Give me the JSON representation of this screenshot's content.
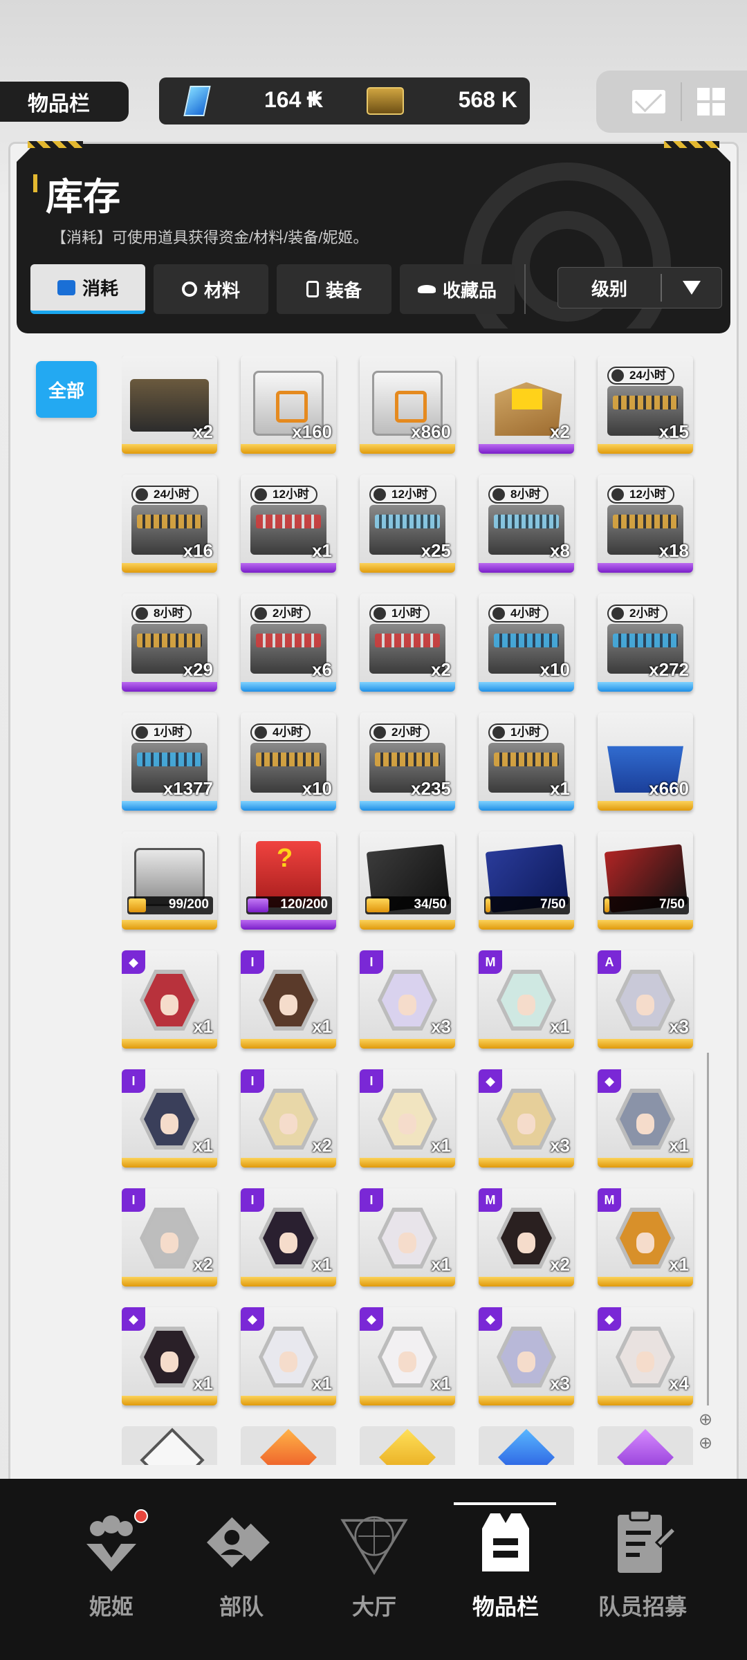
{
  "top_bar": {
    "label": "物品栏",
    "gems": "164 K",
    "plus": "+",
    "credits": "568 K",
    "icons": [
      "gem-icon",
      "ticket-icon",
      "mail-icon",
      "grid-menu-icon"
    ]
  },
  "header": {
    "title": "库存",
    "subtitle": "【消耗】可使用道具获得资金/材料/装备/妮姬。",
    "tabs": [
      {
        "label": "消耗",
        "icon": "consumable-icon"
      },
      {
        "label": "材料",
        "icon": "material-icon"
      },
      {
        "label": "装备",
        "icon": "equipment-icon"
      },
      {
        "label": "收藏品",
        "icon": "collectible-icon"
      }
    ],
    "sort_label": "级别"
  },
  "filter": {
    "all_label": "全部"
  },
  "colors": {
    "accent": "#23a9f2",
    "rarity_orange": "#e09a0c",
    "rarity_purple": "#7a1fc9",
    "rarity_blue": "#1f8fe6",
    "badge_purple": "#7a28d6",
    "notification": "#e8463d"
  },
  "items": [
    {
      "kind": "dark",
      "qty": "x2",
      "rarity": "orange"
    },
    {
      "kind": "crate",
      "qty": "x160",
      "rarity": "orange"
    },
    {
      "kind": "crate",
      "qty": "x860",
      "rarity": "orange"
    },
    {
      "kind": "box",
      "qty": "x2",
      "rarity": "purple"
    },
    {
      "kind": "chest-gold",
      "timer": "24小时",
      "qty": "x15",
      "rarity": "orange"
    },
    {
      "kind": "chest-gold",
      "timer": "24小时",
      "qty": "x16",
      "rarity": "orange"
    },
    {
      "kind": "chest-red",
      "timer": "12小时",
      "qty": "x1",
      "rarity": "purple"
    },
    {
      "kind": "chest-teal",
      "timer": "12小时",
      "qty": "x25",
      "rarity": "orange"
    },
    {
      "kind": "chest-teal",
      "timer": "8小时",
      "qty": "x8",
      "rarity": "purple"
    },
    {
      "kind": "chest-gold",
      "timer": "12小时",
      "qty": "x18",
      "rarity": "purple"
    },
    {
      "kind": "chest-gold",
      "timer": "8小时",
      "qty": "x29",
      "rarity": "purple"
    },
    {
      "kind": "chest-red",
      "timer": "2小时",
      "qty": "x6",
      "rarity": "blue"
    },
    {
      "kind": "chest-red",
      "timer": "1小时",
      "qty": "x2",
      "rarity": "blue"
    },
    {
      "kind": "chest-blue",
      "timer": "4小时",
      "qty": "x10",
      "rarity": "blue"
    },
    {
      "kind": "chest-blue",
      "timer": "2小时",
      "qty": "x272",
      "rarity": "blue"
    },
    {
      "kind": "chest-blue",
      "timer": "1小时",
      "qty": "x1377",
      "rarity": "blue"
    },
    {
      "kind": "chest-gold",
      "timer": "4小时",
      "qty": "x10",
      "rarity": "blue"
    },
    {
      "kind": "chest-gold",
      "timer": "2小时",
      "qty": "x235",
      "rarity": "blue"
    },
    {
      "kind": "chest-gold",
      "timer": "1小时",
      "qty": "x1",
      "rarity": "blue"
    },
    {
      "kind": "bin",
      "qty": "x660",
      "rarity": "orange"
    },
    {
      "kind": "case",
      "progress": "99/200",
      "fill": 0.495,
      "fill_color": "orange",
      "rarity": "orange"
    },
    {
      "kind": "lucky",
      "progress": "120/200",
      "fill": 0.6,
      "fill_color": "purple",
      "rarity": "purple"
    },
    {
      "kind": "folder1",
      "progress": "34/50",
      "fill": 0.68,
      "fill_color": "orange",
      "rarity": "orange"
    },
    {
      "kind": "folder2",
      "progress": "7/50",
      "fill": 0.14,
      "fill_color": "orange",
      "rarity": "orange"
    },
    {
      "kind": "folder3",
      "progress": "7/50",
      "fill": 0.14,
      "fill_color": "orange",
      "rarity": "orange"
    },
    {
      "kind": "nikke",
      "badge": "◆",
      "qty": "x1",
      "rarity": "orange",
      "hair": "#b8323c"
    },
    {
      "kind": "nikke",
      "badge": "I",
      "qty": "x1",
      "rarity": "orange",
      "hair": "#5a3a2a"
    },
    {
      "kind": "nikke",
      "badge": "I",
      "qty": "x3",
      "rarity": "orange",
      "hair": "#d9d2ee"
    },
    {
      "kind": "nikke",
      "badge": "M",
      "qty": "x1",
      "rarity": "orange",
      "hair": "#cfe8e2"
    },
    {
      "kind": "nikke",
      "badge": "A",
      "qty": "x3",
      "rarity": "orange",
      "hair": "#c9c9d8"
    },
    {
      "kind": "nikke",
      "badge": "I",
      "qty": "x1",
      "rarity": "orange",
      "hair": "#3a3f5a"
    },
    {
      "kind": "nikke",
      "badge": "I",
      "qty": "x2",
      "rarity": "orange",
      "hair": "#e8d7a8"
    },
    {
      "kind": "nikke",
      "badge": "I",
      "qty": "x1",
      "rarity": "orange",
      "hair": "#f1e4c0"
    },
    {
      "kind": "nikke",
      "badge": "◆",
      "qty": "x3",
      "rarity": "orange",
      "hair": "#e6cf9a"
    },
    {
      "kind": "nikke",
      "badge": "◆",
      "qty": "x1",
      "rarity": "orange",
      "hair": "#8a93a8"
    },
    {
      "kind": "nikke",
      "badge": "I",
      "qty": "x2",
      "rarity": "orange",
      "hair": "#bdbdbd"
    },
    {
      "kind": "nikke",
      "badge": "I",
      "qty": "x1",
      "rarity": "orange",
      "hair": "#2a2030"
    },
    {
      "kind": "nikke",
      "badge": "I",
      "qty": "x1",
      "rarity": "orange",
      "hair": "#e8e4ea"
    },
    {
      "kind": "nikke",
      "badge": "M",
      "qty": "x2",
      "rarity": "orange",
      "hair": "#2a2020"
    },
    {
      "kind": "nikke",
      "badge": "M",
      "qty": "x1",
      "rarity": "orange",
      "hair": "#d8902a"
    },
    {
      "kind": "nikke",
      "badge": "◆",
      "qty": "x1",
      "rarity": "orange",
      "hair": "#2a2028"
    },
    {
      "kind": "nikke",
      "badge": "◆",
      "qty": "x1",
      "rarity": "orange",
      "hair": "#e8e8ee"
    },
    {
      "kind": "nikke",
      "badge": "◆",
      "qty": "x1",
      "rarity": "orange",
      "hair": "#f2f0f2"
    },
    {
      "kind": "nikke",
      "badge": "◆",
      "qty": "x3",
      "rarity": "orange",
      "hair": "#b8b8d8"
    },
    {
      "kind": "nikke",
      "badge": "◆",
      "qty": "x4",
      "rarity": "orange",
      "hair": "#e9e2e0"
    }
  ],
  "peek_row": [
    "white",
    "orange",
    "yellow",
    "blue",
    "purple"
  ],
  "side_icons": [
    "⊕",
    "⊕"
  ],
  "bottom_nav": [
    {
      "label": "妮姬",
      "icon": "nikke-group-icon",
      "active": false
    },
    {
      "label": "部队",
      "icon": "squad-icon",
      "active": false
    },
    {
      "label": "大厅",
      "icon": "lobby-icon",
      "active": false
    },
    {
      "label": "物品栏",
      "icon": "inventory-icon",
      "active": true
    },
    {
      "label": "队员招募",
      "icon": "recruit-icon",
      "active": false
    }
  ]
}
